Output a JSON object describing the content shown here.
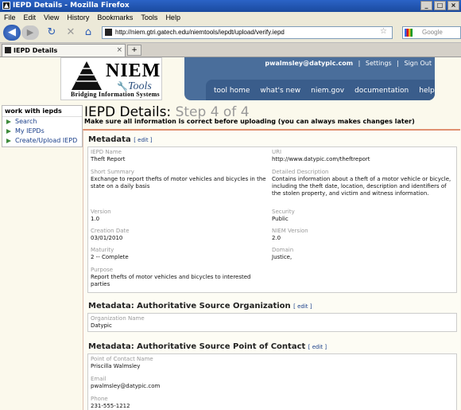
{
  "window": {
    "title": "IEPD Details - Mozilla Firefox",
    "minimize": "_",
    "maximize": "□",
    "close": "×"
  },
  "menu": [
    "File",
    "Edit",
    "View",
    "History",
    "Bookmarks",
    "Tools",
    "Help"
  ],
  "toolbar": {
    "back_icon": "back-arrow-icon",
    "url": "http://niem.gtri.gatech.edu/niemtools/iepdt/upload/verify.iepd",
    "search_placeholder": "Google",
    "reload_glyph": "↻",
    "stop_glyph": "✕",
    "home_glyph": "⌂",
    "star_glyph": "☆"
  },
  "tab": {
    "title": "IEPD Details",
    "close": "×",
    "new": "+"
  },
  "logo": {
    "big": "NIEM",
    "tools": "Tools",
    "tagline": "Bridging Information Systems"
  },
  "header": {
    "user": "pwalmsley@datypic.com",
    "settings": "Settings",
    "signout": "Sign Out",
    "sep": "|",
    "nav": [
      "tool home",
      "what's new",
      "niem.gov",
      "documentation",
      "help"
    ]
  },
  "sidebar": {
    "heading": "work with iepds",
    "items": [
      {
        "label": "Search"
      },
      {
        "label": "My IEPDs"
      },
      {
        "label": "Create/Upload IEPD"
      }
    ]
  },
  "page": {
    "title": "IEPD Details:",
    "step": "Step 4 of 4",
    "subtitle": "Make sure all information is correct before uploading (you can always makes changes later)"
  },
  "edit_label": "[ edit ]",
  "metadata": {
    "heading": "Metadata",
    "iepd_name": {
      "label": "IEPD Name",
      "value": "Theft Report"
    },
    "uri": {
      "label": "URI",
      "value": "http://www.datypic.com/theftreport"
    },
    "short_summary": {
      "label": "Short Summary",
      "value": "Exchange to report thefts of motor vehicles and bicycles in the state on a daily basis"
    },
    "detailed_description": {
      "label": "Detailed Description",
      "value": "Contains information about a theft of a motor vehicle or bicycle, including the theft date, location, description and identifiers of the stolen property, and victim and witness information."
    },
    "version": {
      "label": "Version",
      "value": "1.0"
    },
    "security": {
      "label": "Security",
      "value": "Public"
    },
    "creation_date": {
      "label": "Creation Date",
      "value": "03/01/2010"
    },
    "niem_version": {
      "label": "NIEM Version",
      "value": "2.0"
    },
    "maturity": {
      "label": "Maturity",
      "value": "2 -- Complete"
    },
    "domain": {
      "label": "Domain",
      "value": "Justice,"
    },
    "purpose": {
      "label": "Purpose",
      "value": "Report thefts of motor vehicles and bicycles to interested parties"
    }
  },
  "auth_org": {
    "heading": "Metadata: Authoritative Source Organization",
    "org_name": {
      "label": "Organization Name",
      "value": "Datypic"
    }
  },
  "auth_poc": {
    "heading": "Metadata: Authoritative Source Point of Contact",
    "poc_name": {
      "label": "Point of Contact Name",
      "value": "Priscilla Walmsley"
    },
    "email": {
      "label": "Email",
      "value": "pwalmsley@datypic.com"
    },
    "phone": {
      "label": "Phone",
      "value": "231-555-1212"
    }
  }
}
